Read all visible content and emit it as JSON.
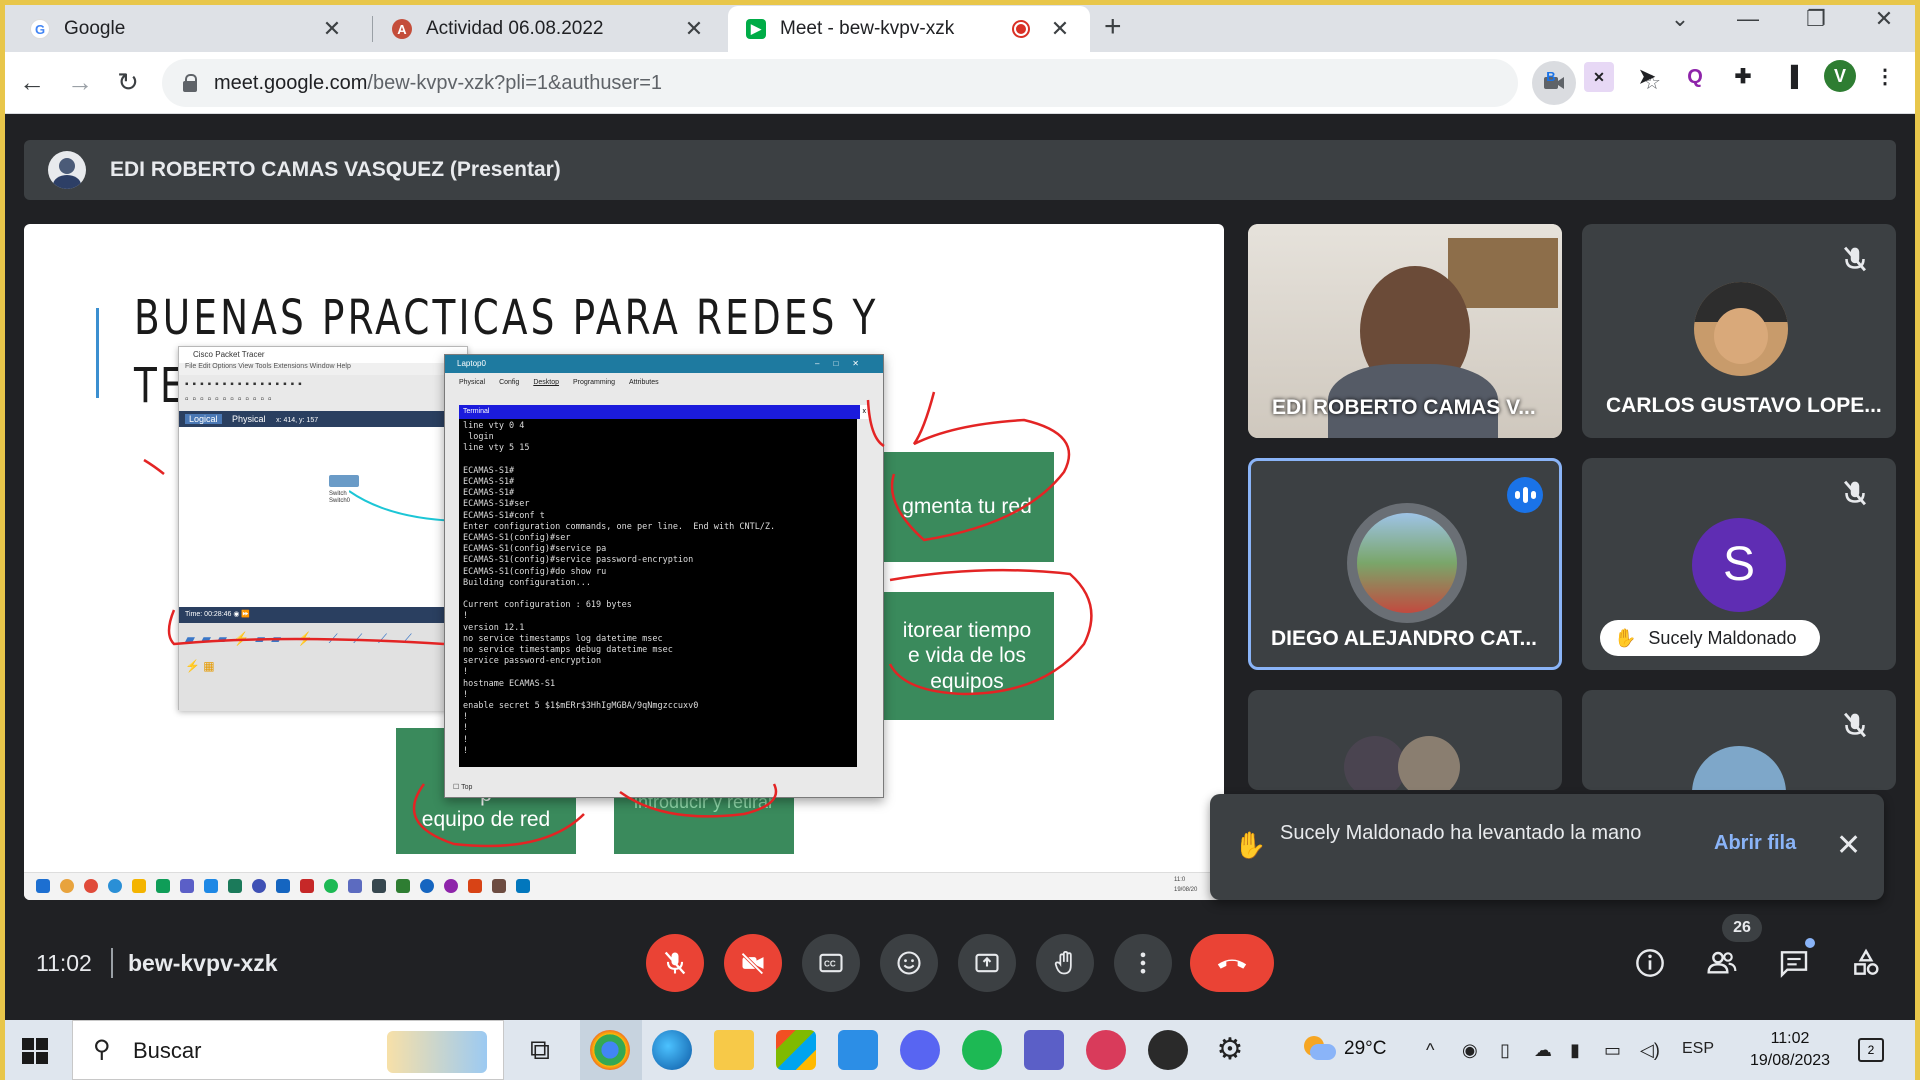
{
  "browser": {
    "tabs": [
      {
        "label": "Google",
        "icon": "google-g-icon"
      },
      {
        "label": "Actividad 06.08.2022",
        "icon": "moodle-icon"
      },
      {
        "label": "Meet - bew-kvpv-xzk",
        "icon": "google-meet-icon",
        "active": true,
        "recording": true
      }
    ],
    "url_host": "meet.google.com",
    "url_path": "/bew-kvpv-xzk?pli=1&authuser=1",
    "profile_initial": "V",
    "extension_b": "B",
    "accent": "#e8c64a"
  },
  "meet": {
    "presenter_label": "EDI ROBERTO CAMAS VASQUEZ (Presentar)",
    "slide": {
      "title_line1": "BUENAS PRACTICAS PARA REDES Y",
      "title_line2": "TE",
      "box1": "gmenta tu red",
      "box2": "itorear tiempo\ne vida de los\nequipos",
      "box3": "M\np\nequipo de red",
      "box4": "introducir y retirar",
      "pt_title": "Cisco Packet Tracer",
      "pt_logical": "Logical",
      "pt_physical": "Physical",
      "pt_coords": "x: 414, y: 157",
      "pt_switch": "Switch\nSwitch0",
      "pt_time": "Time: 00:28:46",
      "laptop_title": "Laptop0",
      "laptop_tabs": [
        "Physical",
        "Config",
        "Desktop",
        "Programming",
        "Attributes"
      ],
      "terminal_label": "Terminal",
      "terminal_text": "line vty 0 4\n login\nline vty 5 15\n\nECAMAS-S1#\nECAMAS-S1#\nECAMAS-S1#\nECAMAS-S1#ser\nECAMAS-S1#conf t\nEnter configuration commands, one per line.  End with CNTL/Z.\nECAMAS-S1(config)#ser\nECAMAS-S1(config)#service pa\nECAMAS-S1(config)#service password-encryption\nECAMAS-S1(config)#do show ru\nBuilding configuration...\n\nCurrent configuration : 619 bytes\n!\nversion 12.1\nno service timestamps log datetime msec\nno service timestamps debug datetime msec\nservice password-encryption\n!\nhostname ECAMAS-S1\n!\nenable secret 5 $1$mERr$3HhIgMGBA/9qNmgzccuxv0\n!\n!\n!\n!",
      "top_checkbox": "Top",
      "slide_clock": "11:0\n19/08/20"
    },
    "tiles": [
      {
        "name": "EDI ROBERTO CAMAS V...",
        "muted": false
      },
      {
        "name": "CARLOS GUSTAVO LOPE...",
        "muted": true
      },
      {
        "name": "DIEGO ALEJANDRO CAT...",
        "speaking": true
      },
      {
        "name": "Sucely Maldonado",
        "avatar_letter": "S",
        "muted": true,
        "hand_raised": true
      },
      {
        "name": "",
        "muted": false
      },
      {
        "name": "",
        "muted": true
      }
    ],
    "toast": {
      "message": "Sucely Maldonado ha levantado la mano",
      "action": "Abrir fila"
    },
    "time": "11:02",
    "meeting_code": "bew-kvpv-xzk",
    "participants_count": "26",
    "colors": {
      "danger": "#ea4335",
      "link": "#8ab4f8",
      "surface": "#3c4043",
      "background": "#202124",
      "speaking": "#8ab4f8",
      "avatar_purple": "#5f2db3"
    }
  },
  "taskbar": {
    "search_placeholder": "Buscar",
    "temperature": "29°C",
    "language": "ESP",
    "time": "11:02",
    "date": "19/08/2023",
    "notifications": "2"
  }
}
